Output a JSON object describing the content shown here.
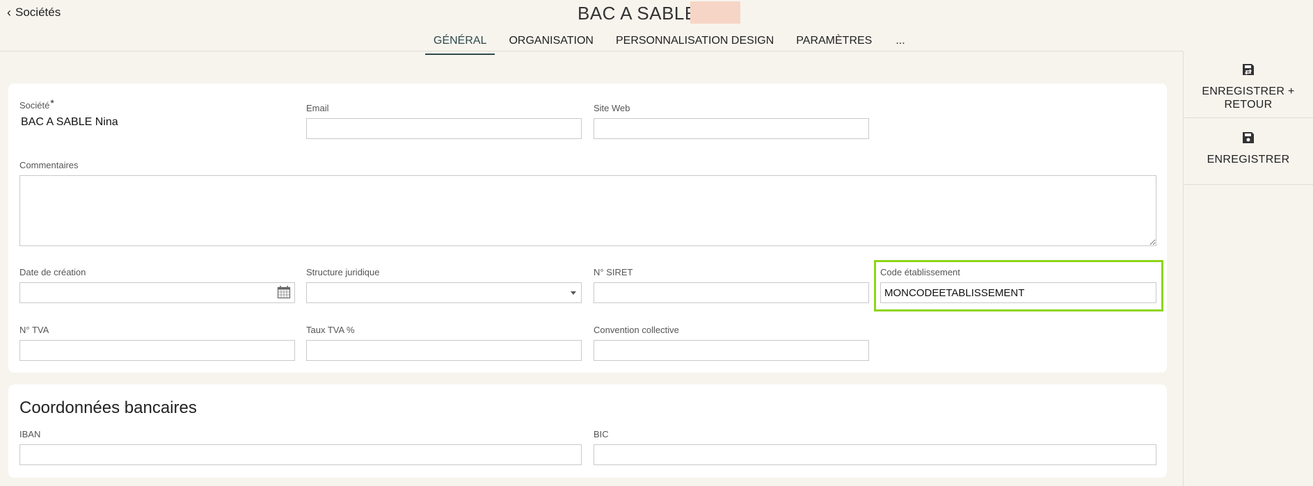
{
  "header": {
    "back_label": "Sociétés",
    "title": "BAC A SABLE",
    "tabs": [
      {
        "label": "GÉNÉRAL",
        "active": true
      },
      {
        "label": "ORGANISATION",
        "active": false
      },
      {
        "label": "PERSONNALISATION DESIGN",
        "active": false
      },
      {
        "label": "PARAMÈTRES",
        "active": false
      },
      {
        "label": "...",
        "active": false
      }
    ]
  },
  "sidebar": {
    "save_return_label_1": "ENREGISTRER +",
    "save_return_label_2": "RETOUR",
    "save_label": "ENREGISTRER"
  },
  "general": {
    "societe": {
      "label": "Société",
      "required_mark": "*",
      "value": "BAC A SABLE Nina"
    },
    "email": {
      "label": "Email",
      "value": ""
    },
    "site_web": {
      "label": "Site Web",
      "value": ""
    },
    "commentaires": {
      "label": "Commentaires",
      "value": ""
    },
    "date_creation": {
      "label": "Date de création",
      "value": ""
    },
    "structure_juridique": {
      "label": "Structure juridique",
      "value": ""
    },
    "siret": {
      "label": "N° SIRET",
      "value": ""
    },
    "code_etablissement": {
      "label": "Code établissement",
      "value": "MONCODEETABLISSEMENT"
    },
    "tva": {
      "label": "N° TVA",
      "value": ""
    },
    "taux_tva": {
      "label": "Taux TVA %",
      "value": ""
    },
    "convention": {
      "label": "Convention collective",
      "value": ""
    }
  },
  "bank": {
    "title": "Coordonnées bancaires",
    "iban": {
      "label": "IBAN",
      "value": ""
    },
    "bic": {
      "label": "BIC",
      "value": ""
    }
  },
  "colors": {
    "highlight": "#8fd41a",
    "tab_active": "#2e4a4a",
    "title_badge": "#f6d5c6"
  }
}
